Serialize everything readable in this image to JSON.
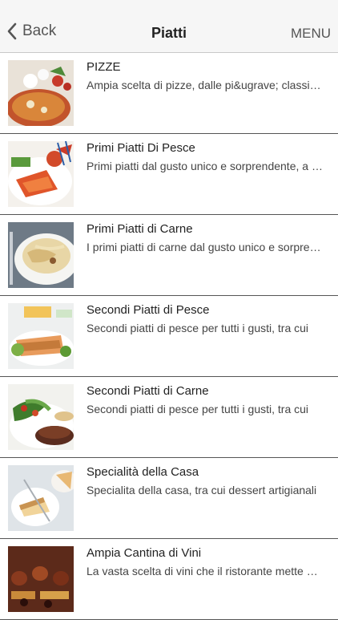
{
  "nav": {
    "back_label": "Back",
    "title": "Piatti",
    "menu_label": "MENU"
  },
  "items": [
    {
      "name": "PIZZE",
      "desc": "Ampia scelta di pizze, dalle pi&ugrave; classiche",
      "image": "pizza-photo"
    },
    {
      "name": "Primi Piatti Di Pesce",
      "desc": "Primi piatti dal gusto unico e sorprendente, a base di pesce",
      "image": "seafood-pasta-photo"
    },
    {
      "name": "Primi Piatti di Carne",
      "desc": "I primi piatti di carne dal gusto unico e sorprendente",
      "image": "meat-pasta-photo"
    },
    {
      "name": "Secondi Piatti di Pesce",
      "desc": "Secondi piatti di pesce per tutti i gusti, tra cui",
      "image": "fish-dish-photo"
    },
    {
      "name": "Secondi Piatti di Carne",
      "desc": "Secondi piatti di pesce per tutti i gusti, tra cui",
      "image": "meat-dish-photo"
    },
    {
      "name": "Specialità della Casa",
      "desc": "Specialita della casa, tra cui dessert artigianali",
      "image": "dessert-photo"
    },
    {
      "name": "Ampia Cantina di Vini",
      "desc": "La vasta scelta di vini che il ristorante mette a disposizione",
      "image": "wine-cellar-photo"
    }
  ]
}
